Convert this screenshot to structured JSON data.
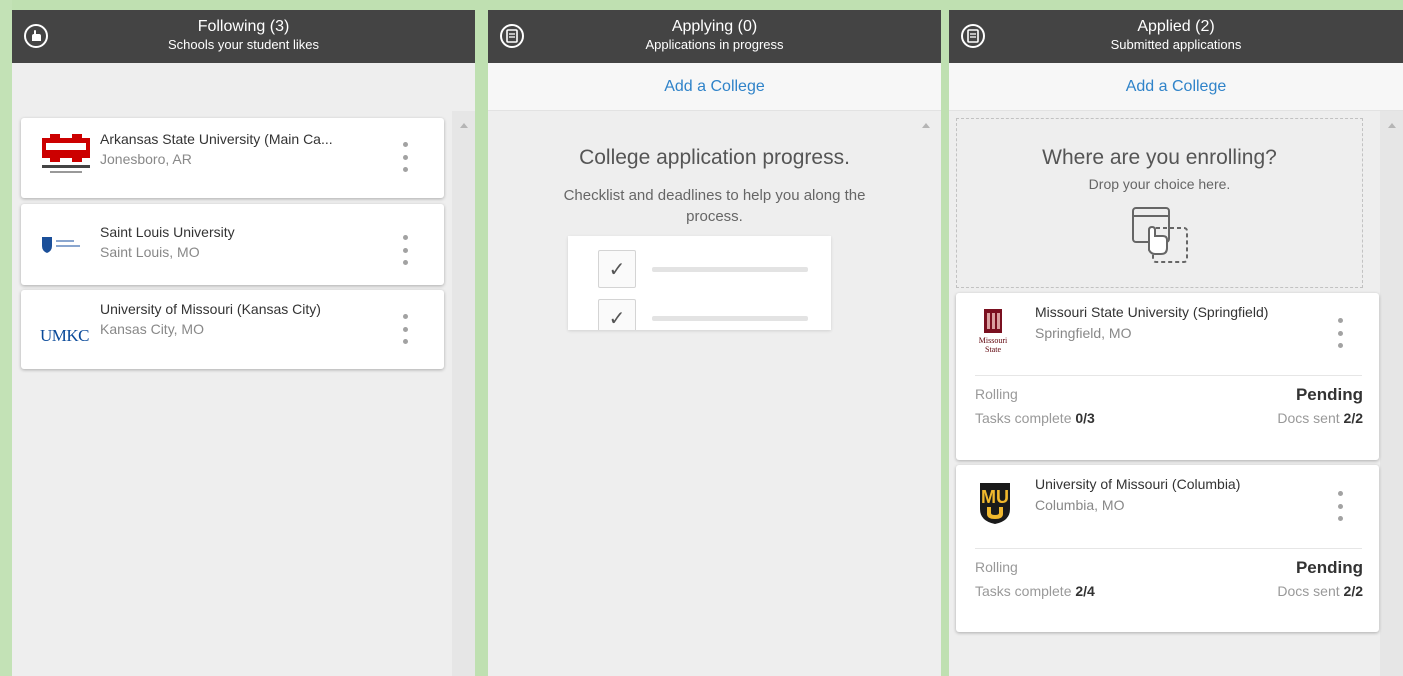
{
  "following": {
    "title": "Following (3)",
    "subtitle": "Schools your student likes",
    "icon": "hand-icon",
    "schools": [
      {
        "name": "Arkansas State University (Main Ca...",
        "location": "Jonesboro, AR",
        "logo_text": "ARKANSAS STATE",
        "logo_color": "#cc0000"
      },
      {
        "name": "Saint Louis University",
        "location": "Saint Louis, MO",
        "logo_text": "SAINT LOUIS",
        "logo_color": "#1b4f99"
      },
      {
        "name": "University of Missouri (Kansas City)",
        "location": "Kansas City, MO",
        "logo_text": "UMKC",
        "logo_color": "#0a4a9a"
      }
    ]
  },
  "applying": {
    "title": "Applying (0)",
    "subtitle": "Applications in progress",
    "icon": "document-icon",
    "add_label": "Add a College",
    "empty_title": "College application progress.",
    "empty_desc": "Checklist and deadlines to help you along the process."
  },
  "applied": {
    "title": "Applied (2)",
    "subtitle": "Submitted applications",
    "icon": "document-icon",
    "add_label": "Add a College",
    "drop_title": "Where are you enrolling?",
    "drop_sub": "Drop your choice here.",
    "schools": [
      {
        "name": "Missouri State University (Springfield)",
        "location": "Springfield, MO",
        "logo_text": "Missouri State",
        "logo_color": "#5e0009",
        "deadline": "Rolling",
        "status": "Pending",
        "tasks_label": "Tasks complete",
        "tasks_value": "0/3",
        "docs_label": "Docs sent",
        "docs_value": "2/2"
      },
      {
        "name": "University of Missouri (Columbia)",
        "location": "Columbia, MO",
        "logo_text": "MU",
        "logo_color": "#f1b82d",
        "deadline": "Rolling",
        "status": "Pending",
        "tasks_label": "Tasks complete",
        "tasks_value": "2/4",
        "docs_label": "Docs sent",
        "docs_value": "2/2"
      }
    ]
  },
  "colors": {
    "header_bg": "#444444",
    "link": "#2f83c9",
    "column_bg": "#eeeeee",
    "side_strip": "#c3e2b6"
  }
}
